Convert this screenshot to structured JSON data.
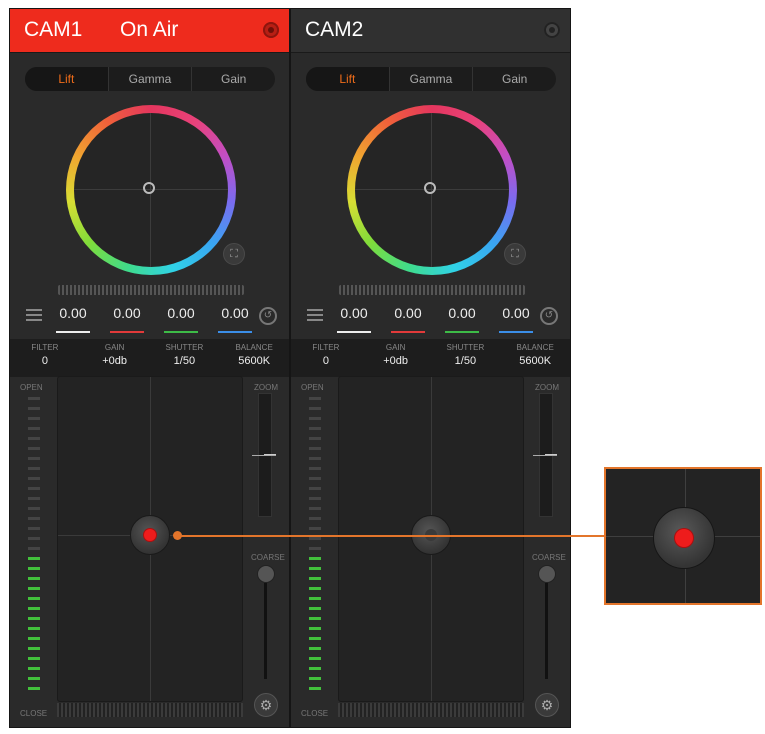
{
  "cameras": [
    {
      "name": "CAM1",
      "on_air_label": "On Air",
      "on_air": true,
      "tabs": [
        "Lift",
        "Gamma",
        "Gain"
      ],
      "active_tab": "Lift",
      "values": [
        "0.00",
        "0.00",
        "0.00",
        "0.00"
      ],
      "info": [
        {
          "label": "FILTER",
          "value": "0"
        },
        {
          "label": "GAIN",
          "value": "+0db"
        },
        {
          "label": "SHUTTER",
          "value": "1/50"
        },
        {
          "label": "BALANCE",
          "value": "5600K"
        }
      ],
      "iris_open_label": "OPEN",
      "iris_close_label": "CLOSE",
      "zoom_label": "ZOOM",
      "coarse_label": "COARSE"
    },
    {
      "name": "CAM2",
      "on_air": false,
      "tabs": [
        "Lift",
        "Gamma",
        "Gain"
      ],
      "active_tab": "Lift",
      "values": [
        "0.00",
        "0.00",
        "0.00",
        "0.00"
      ],
      "info": [
        {
          "label": "FILTER",
          "value": "0"
        },
        {
          "label": "GAIN",
          "value": "+0db"
        },
        {
          "label": "SHUTTER",
          "value": "1/50"
        },
        {
          "label": "BALANCE",
          "value": "5600K"
        }
      ],
      "iris_open_label": "OPEN",
      "iris_close_label": "CLOSE",
      "zoom_label": "ZOOM",
      "coarse_label": "COARSE"
    }
  ],
  "colors": {
    "on_air": "#ee2b1d",
    "active_tab": "#ef6c1a",
    "callout": "#e3752b",
    "knob_live": "#ee1c1c"
  }
}
